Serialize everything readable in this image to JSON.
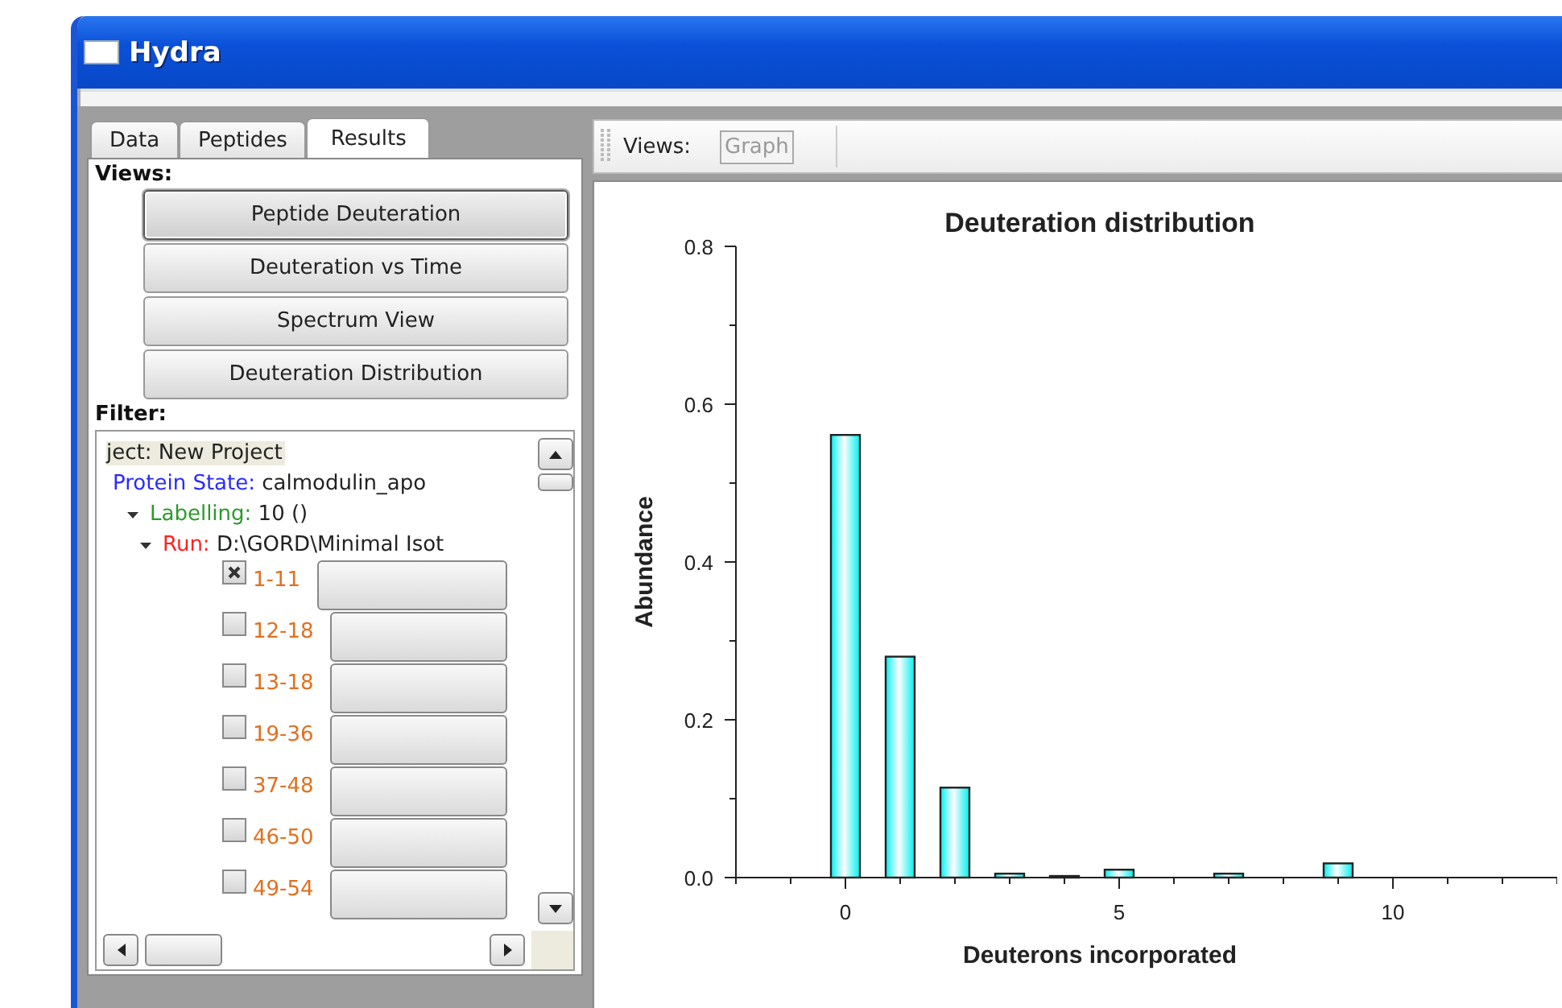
{
  "window": {
    "title": "Hydra"
  },
  "tabs": [
    {
      "label": "Data",
      "selected": false
    },
    {
      "label": "Peptides",
      "selected": false
    },
    {
      "label": "Results",
      "selected": true
    }
  ],
  "views_label": "Views:",
  "view_buttons": [
    {
      "label": "Peptide Deuteration",
      "selected": true
    },
    {
      "label": "Deuteration vs Time",
      "selected": false
    },
    {
      "label": "Spectrum View",
      "selected": false
    },
    {
      "label": "Deuteration Distribution",
      "selected": false
    }
  ],
  "filter_label": "Filter:",
  "filter_tree": [
    {
      "key": "ject:",
      "value": "New Project",
      "selected": true,
      "children": [
        {
          "key": "Protein State:",
          "value": "calmodulin_apo",
          "color": "#2a2aff",
          "children": [
            {
              "key": "Labelling:",
              "value": "10 ()",
              "color": "#2a9a2a",
              "expanded": true,
              "children": [
                {
                  "key": "Run:",
                  "value": "D:\\GORD\\Minimal Isot",
                  "color": "#ff2020",
                  "expanded": true,
                  "peptides": [
                    {
                      "label": "1-11",
                      "checked": true
                    },
                    {
                      "label": "12-18",
                      "checked": false
                    },
                    {
                      "label": "13-18",
                      "checked": false
                    },
                    {
                      "label": "19-36",
                      "checked": false
                    },
                    {
                      "label": "37-48",
                      "checked": false
                    },
                    {
                      "label": "46-50",
                      "checked": false
                    },
                    {
                      "label": "49-54",
                      "checked": false
                    }
                  ]
                }
              ]
            }
          ]
        }
      ]
    }
  ],
  "toolbar": {
    "label": "Views:",
    "buttons": [
      {
        "label": "Graph",
        "disabled": true
      }
    ]
  },
  "chart": {
    "chart_data": {
      "type": "bar",
      "title": "Deuteration distribution",
      "xlabel": "Deuterons incorporated",
      "ylabel": "Abundance",
      "x": [
        0,
        1,
        2,
        3,
        4,
        5,
        7,
        9
      ],
      "values": [
        0.561,
        0.28,
        0.114,
        0.005,
        0.002,
        0.01,
        0.005,
        0.018
      ],
      "xlim": [
        -2,
        13
      ],
      "ylim": [
        0,
        0.8
      ],
      "xticks": [
        0,
        5,
        10
      ],
      "yticks": [
        {
          "value": 0,
          "label": "0.0"
        },
        {
          "value": 0.2,
          "label": "0.2"
        },
        {
          "value": 0.4,
          "label": "0.4"
        },
        {
          "value": 0.6,
          "label": "0.6"
        },
        {
          "value": 0.8,
          "label": "0.8"
        }
      ]
    }
  }
}
